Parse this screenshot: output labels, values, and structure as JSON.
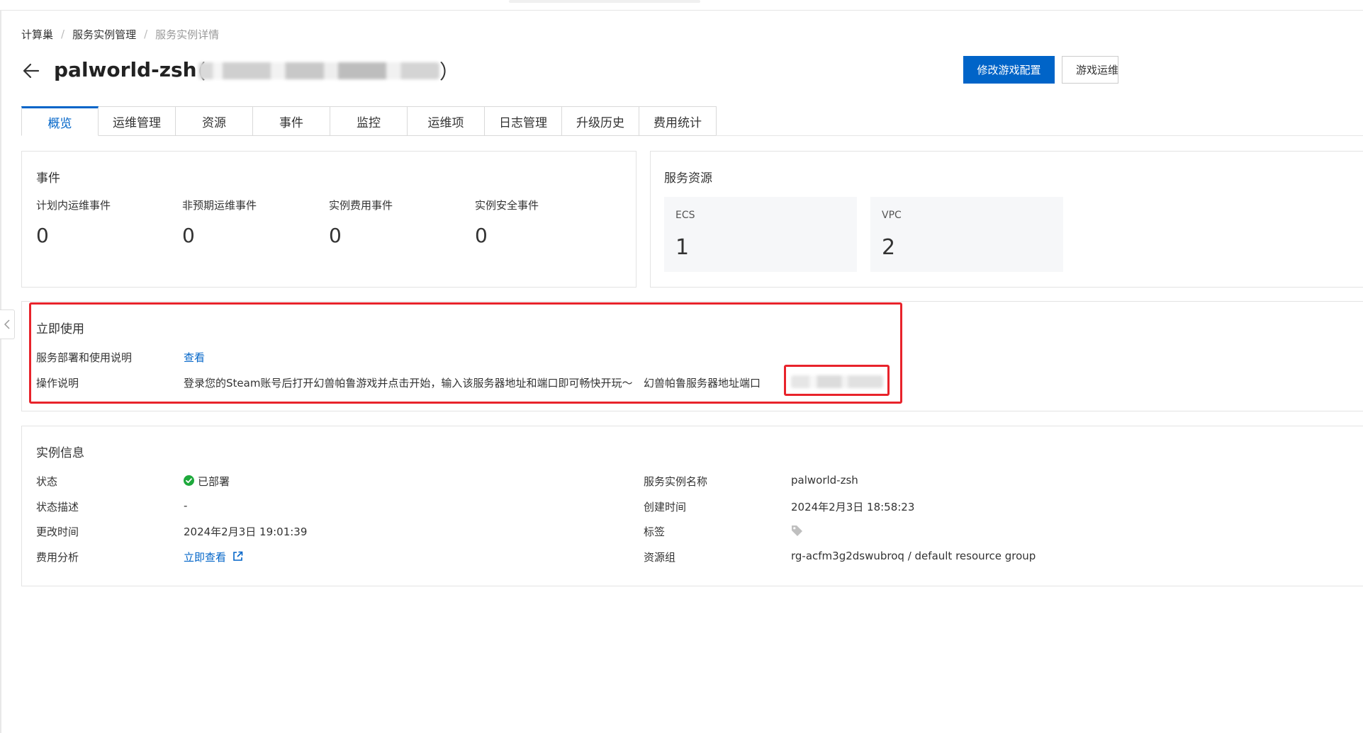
{
  "breadcrumb": {
    "items": [
      "计算巢",
      "服务实例管理",
      "服务实例详情"
    ],
    "separator": "/"
  },
  "header": {
    "title": "palworld-zsh",
    "paren_open": "（",
    "paren_close": "）",
    "primary_button": "修改游戏配置",
    "secondary_button": "游戏运维"
  },
  "tabs": [
    {
      "label": "概览",
      "active": true
    },
    {
      "label": "运维管理"
    },
    {
      "label": "资源"
    },
    {
      "label": "事件"
    },
    {
      "label": "监控"
    },
    {
      "label": "运维项"
    },
    {
      "label": "日志管理"
    },
    {
      "label": "升级历史"
    },
    {
      "label": "费用统计"
    }
  ],
  "events_card": {
    "title": "事件",
    "metrics": [
      {
        "label": "计划内运维事件",
        "value": "0"
      },
      {
        "label": "非预期运维事件",
        "value": "0"
      },
      {
        "label": "实例费用事件",
        "value": "0"
      },
      {
        "label": "实例安全事件",
        "value": "0"
      }
    ]
  },
  "resources_card": {
    "title": "服务资源",
    "items": [
      {
        "label": "ECS",
        "value": "1"
      },
      {
        "label": "VPC",
        "value": "2"
      }
    ]
  },
  "use_now_card": {
    "title": "立即使用",
    "deploy_label": "服务部署和使用说明",
    "deploy_link": "查看",
    "ops_label": "操作说明",
    "ops_text": "登录您的Steam账号后打开幻兽帕鲁游戏并点击开始，输入该服务器地址和端口即可畅快开玩～",
    "server_label": "幻兽帕鲁服务器地址端口"
  },
  "instance_card": {
    "title": "实例信息",
    "status_label": "状态",
    "status_value": "已部署",
    "status_color": "#1ea93c",
    "status_desc_label": "状态描述",
    "status_desc_value": "-",
    "modified_label": "更改时间",
    "modified_value": "2024年2月3日 19:01:39",
    "cost_label": "费用分析",
    "cost_link": "立即查看",
    "name_label": "服务实例名称",
    "name_value": "palworld-zsh",
    "created_label": "创建时间",
    "created_value": "2024年2月3日 18:58:23",
    "tags_label": "标签",
    "rg_label": "资源组",
    "rg_value": "rg-acfm3g2dswubroq / default resource group"
  },
  "colors": {
    "accent": "#0064c8",
    "highlight": "#e8232b"
  }
}
